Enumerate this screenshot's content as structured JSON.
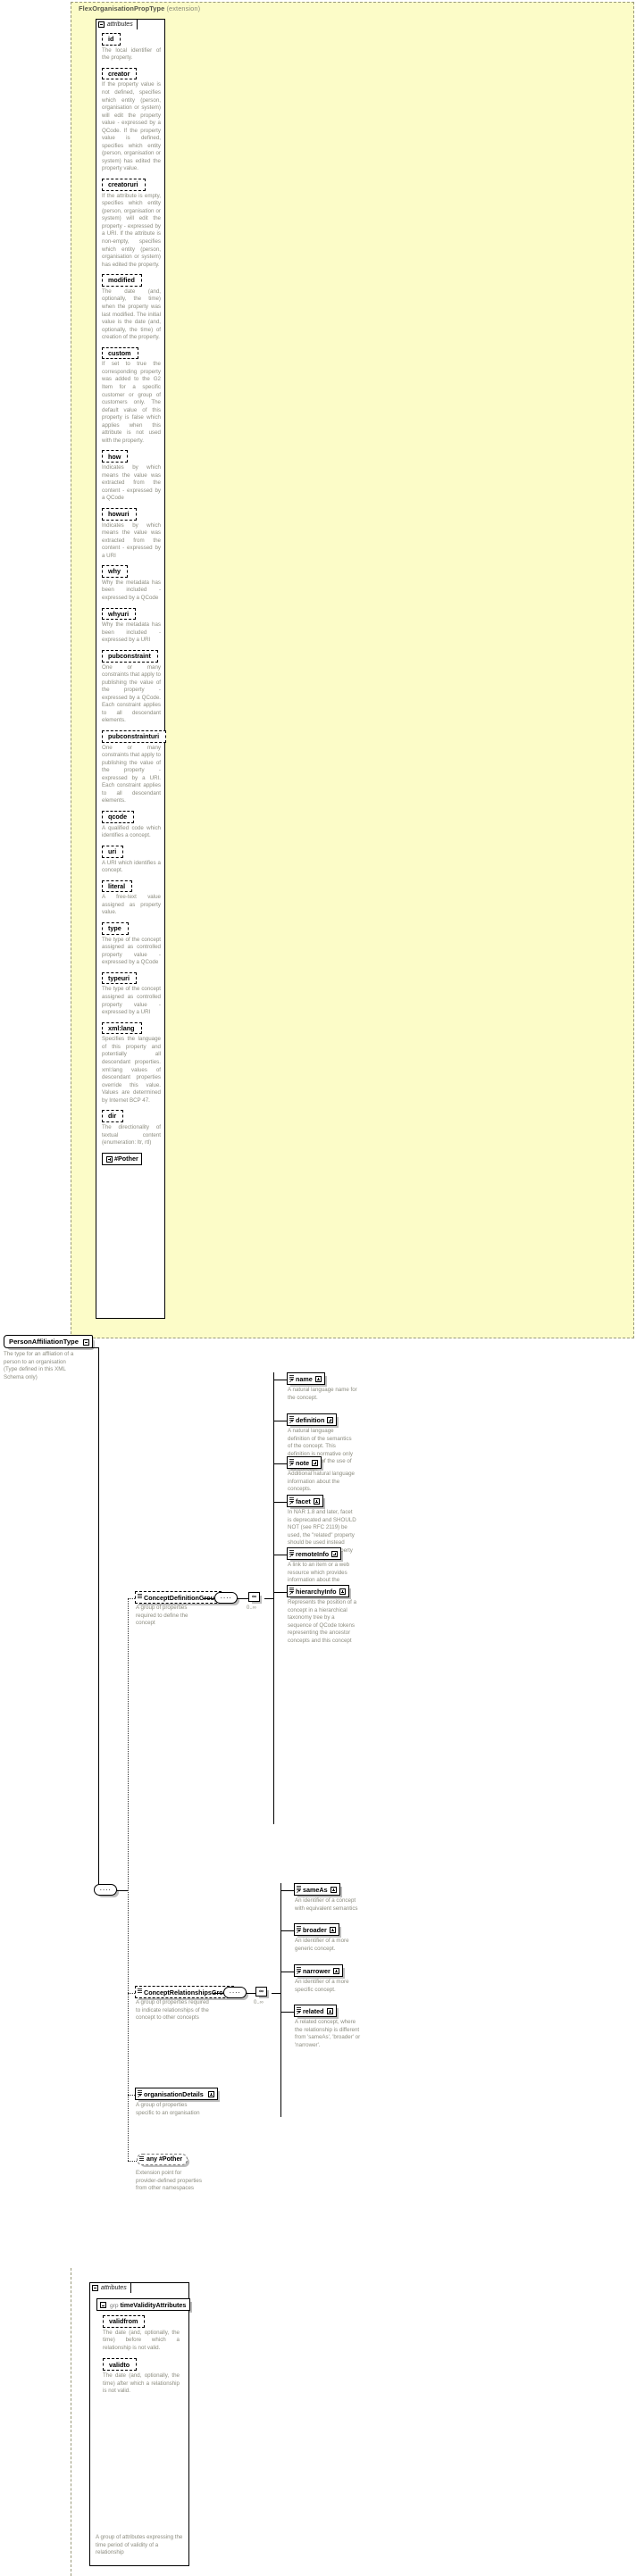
{
  "diagram": {
    "title": "FlexOrganisationPropType",
    "title_suffix": "(extension)",
    "attributes_label": "attributes",
    "any_label": "any #Pother",
    "any_label2": "any #Pother",
    "dir_enum": "#Pother"
  },
  "root_type": {
    "name": "PersonAffiliationType",
    "desc": "The type for an affliation of a person to an organisation (Type defined in this XML Schema only)"
  },
  "attributes": [
    {
      "name": "id",
      "desc": "The local identifier of the property."
    },
    {
      "name": "creator",
      "desc": "If the property value is not defined, specifies which entity (person, organisation or system) will edit the property value - expressed by a QCode. If the property value is defined, specifies which entity (person, organisation or system) has edited the property value."
    },
    {
      "name": "creatoruri",
      "desc": "If the attribute is empty, specifies which entity (person, organisation or system) will edit the property - expressed by a URI. If the attribute is non-empty, specifies which entity (person, organisation or system) has edited the property."
    },
    {
      "name": "modified",
      "desc": "The date (and, optionally, the time) when the property was last modified. The initial value is the date (and, optionally, the time) of creation of the property."
    },
    {
      "name": "custom",
      "desc": "If set to true the corresponding property was added to the G2 Item for a specific customer or group of customers only. The default value of this property is false which applies when this attribute is not used with the property."
    },
    {
      "name": "how",
      "desc": "Indicates by which means the value was extracted from the content - expressed by a QCode"
    },
    {
      "name": "howuri",
      "desc": "Indicates by which means the value was extracted from the content - expressed by a URI"
    },
    {
      "name": "why",
      "desc": "Why the metadata has been included - expressed by a QCode"
    },
    {
      "name": "whyuri",
      "desc": "Why the metadata has been included - expressed by a URI"
    },
    {
      "name": "pubconstraint",
      "desc": "One or many constraints that apply to publishing the value of the property - expressed by a QCode. Each constraint applies to all descendant elements."
    },
    {
      "name": "pubconstrainturi",
      "desc": "One or many constraints that apply to publishing the value of the property - expressed by a URI. Each constraint applies to all descendant elements."
    },
    {
      "name": "qcode",
      "desc": "A qualified code which identifies a concept."
    },
    {
      "name": "uri",
      "desc": "A URI which identifies a concept."
    },
    {
      "name": "literal",
      "desc": "A free-text value assigned as property value."
    },
    {
      "name": "type",
      "desc": "The type of the concept assigned as controlled property value - expressed by a QCode"
    },
    {
      "name": "typeuri",
      "desc": "The type of the concept assigned as controlled property value - expressed by a URI"
    },
    {
      "name": "xml:lang",
      "desc": "Specifies the language of this property and potentially all descendant properties. xml:lang values of descendant properties override this value. Values are determined by Internet BCP 47."
    },
    {
      "name": "dir",
      "desc": "The directionality of textual content (enumeration: ltr, rtl)"
    }
  ],
  "concept_definition_group": {
    "name": "ConceptDefinitionGroup",
    "desc": "A group of properties required to define the concept",
    "cardinality": "0..∞",
    "repeat": "∞",
    "elements": [
      {
        "name": "name",
        "desc": "A natural language name for the concept."
      },
      {
        "name": "definition",
        "desc": "A natural language definition of the semantics of the concept. This definition is normative only for the scope of the use of this concept."
      },
      {
        "name": "note",
        "desc": "Additional natural language information about the concepts."
      },
      {
        "name": "facet",
        "desc": "In NAR 1.8 and later, facet is deprecated and SHOULD NOT (see RFC 2119) be used, the \"related\" property should be used instead (was): An intrinsic property of the concept.]"
      },
      {
        "name": "remoteInfo",
        "desc": "A link to an item or a web resource which provides information about the concept"
      },
      {
        "name": "hierarchyInfo",
        "desc": "Represents the position of a concept in a hierarchical taxonomy tree by a sequence of QCode tokens representing the ancestor concepts and this concept"
      }
    ]
  },
  "concept_relationships_group": {
    "name": "ConceptRelationshipsGroup",
    "desc": "A group of properties required to indicate relationships of the concept to other concepts",
    "cardinality": "0..∞",
    "repeat": "∞",
    "elements": [
      {
        "name": "sameAs",
        "desc": "An identifier of a concept with equivalent semantics"
      },
      {
        "name": "broader",
        "desc": "An identifier of a more generic concept."
      },
      {
        "name": "narrower",
        "desc": "An identifier of a more specific concept."
      },
      {
        "name": "related",
        "desc": "A related concept, where the relationship is different from 'sameAs', 'broader' or 'narrower'."
      }
    ]
  },
  "organisation_details": {
    "name": "organisationDetails",
    "desc": "A group of properties specific to an organisation"
  },
  "any_extension": {
    "label": "any #Pother",
    "desc": "Extension point for provider-defined properties from other namespaces"
  },
  "bottom": {
    "attributes_label": "attributes",
    "group_prefix": "grp",
    "group_name": "timeValidityAttributes",
    "group_desc": "A group of attributes expressing the time period of validity of a relationship",
    "attributes": [
      {
        "name": "validfrom",
        "desc": "The date (and, optionally, the time) before which a relationship is not valid."
      },
      {
        "name": "validto",
        "desc": "The date (and, optionally, the time) after which a relationship is not valid."
      }
    ]
  }
}
